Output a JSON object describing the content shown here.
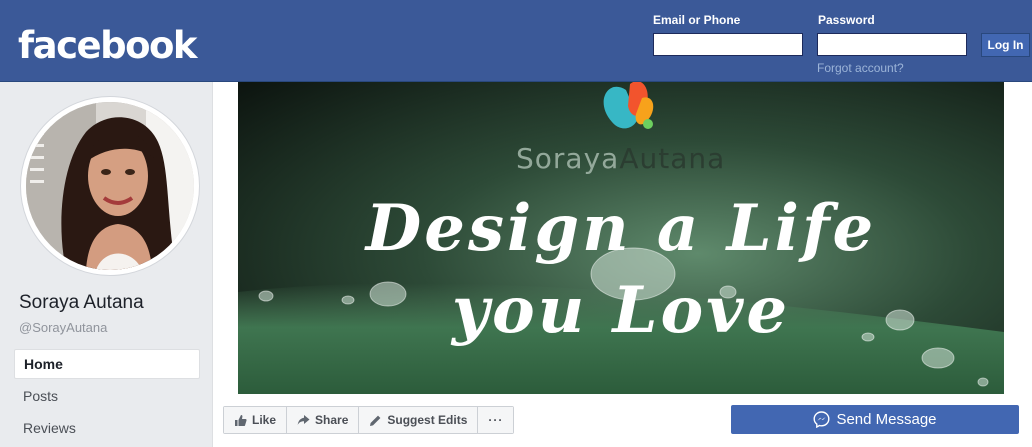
{
  "header": {
    "logo": "facebook",
    "email_label": "Email or Phone",
    "password_label": "Password",
    "email_value": "",
    "password_value": "",
    "login_button": "Log In",
    "forgot_link": "Forgot account?"
  },
  "colors": {
    "brand": "#3b5998",
    "button": "#4267b2",
    "page_bg": "#e9ebee"
  },
  "profile": {
    "name": "Soraya Autana",
    "handle": "@SorayAutana"
  },
  "sidebar": {
    "items": [
      {
        "label": "Home",
        "active": true
      },
      {
        "label": "Posts",
        "active": false
      },
      {
        "label": "Reviews",
        "active": false
      }
    ]
  },
  "cover": {
    "brand_name_light": "Soraya",
    "brand_name_dark": "Autana",
    "headline_line1": "Design a Life",
    "headline_line2": "you Love"
  },
  "actions": {
    "like": "Like",
    "share": "Share",
    "suggest_edits": "Suggest Edits",
    "more": "···",
    "send_message": "Send Message"
  },
  "icons": {
    "like": "thumbs-up-icon",
    "share": "share-arrow-icon",
    "suggest": "pencil-icon",
    "messenger": "messenger-icon"
  }
}
